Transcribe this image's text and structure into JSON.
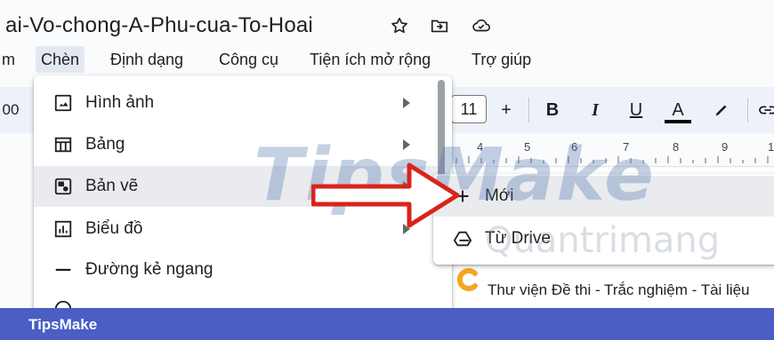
{
  "document": {
    "title": "ai-Vo-chong-A-Phu-cua-To-Hoai"
  },
  "title_icons": [
    "star-icon",
    "move-to-folder-icon",
    "cloud-status-icon"
  ],
  "menubar": {
    "items": [
      {
        "label": "m"
      },
      {
        "label": "Chèn"
      },
      {
        "label": "Định dạng"
      },
      {
        "label": "Công cụ"
      },
      {
        "label": "Tiện ích mở rộng"
      },
      {
        "label": "Trợ giúp"
      }
    ],
    "active_index": 1
  },
  "toolbar": {
    "zoom_partial": "00",
    "font_size": "11",
    "increase_label": "+",
    "bold_label": "B",
    "italic_label": "I",
    "underline_label": "U",
    "text_color_label": "A",
    "text_color": "#000000"
  },
  "ruler": {
    "numbers": [
      "4",
      "5",
      "6",
      "7",
      "8",
      "9",
      "1"
    ]
  },
  "insert_menu": {
    "items": [
      {
        "label": "Hình ảnh",
        "icon": "image-icon",
        "has_submenu": true
      },
      {
        "label": "Bảng",
        "icon": "table-icon",
        "has_submenu": true
      },
      {
        "label": "Bản vẽ",
        "icon": "drawing-icon",
        "has_submenu": true,
        "highlighted": true
      },
      {
        "label": "Biểu đồ",
        "icon": "chart-icon",
        "has_submenu": true
      },
      {
        "label": "Đường kẻ ngang",
        "icon": "horizontal-line-icon",
        "has_submenu": false
      }
    ]
  },
  "drawing_submenu": {
    "items": [
      {
        "label": "Mới",
        "icon": "plus-icon",
        "highlighted": true
      },
      {
        "label": "Từ Drive",
        "icon": "google-drive-icon"
      }
    ]
  },
  "page": {
    "text": "Thư viện Đề thi - Trắc nghiệm - Tài liệu"
  },
  "watermarks": {
    "tipsmake": "TipsMake",
    "quantrimang": "Quantrimang"
  },
  "footer": {
    "label": "TipsMake"
  },
  "colors": {
    "accent_banner": "#4a5ec4",
    "arrow_red": "#d9241b",
    "highlight": "#e9ebee"
  }
}
